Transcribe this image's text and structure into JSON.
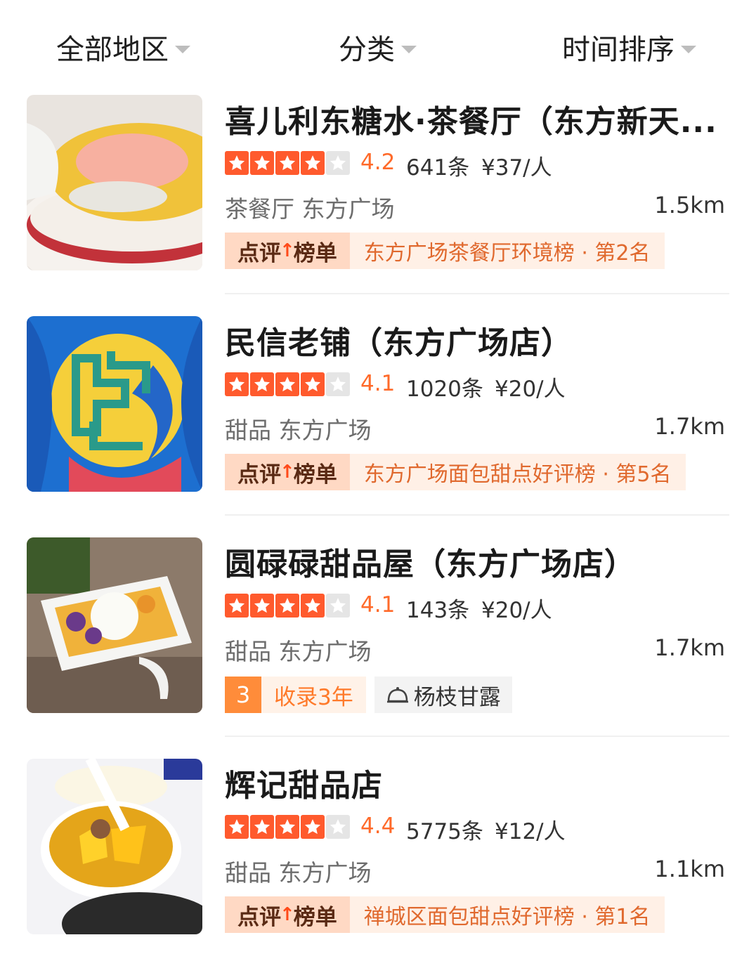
{
  "filters": [
    {
      "label": "全部地区"
    },
    {
      "label": "分类"
    },
    {
      "label": "时间排序"
    }
  ],
  "shops": [
    {
      "name": "喜儿利东糖水·茶餐厅（东方新天...",
      "rating": "4.2",
      "stars": 4,
      "reviews": "641条",
      "price": "¥37/人",
      "category": "茶餐厅 东方广场",
      "distance": "1.5km",
      "rank_tag_left": "点评",
      "rank_tag_right": "榜单",
      "rank_text": "东方广场茶餐厅环境榜 · 第2名"
    },
    {
      "name": "民信老铺（东方广场店）",
      "rating": "4.1",
      "stars": 4,
      "reviews": "1020条",
      "price": "¥20/人",
      "category": "甜品 东方广场",
      "distance": "1.7km",
      "rank_tag_left": "点评",
      "rank_tag_right": "榜单",
      "rank_text": "东方广场面包甜点好评榜 · 第5名"
    },
    {
      "name": "圆碌碌甜品屋（东方广场店）",
      "rating": "4.1",
      "stars": 4,
      "reviews": "143条",
      "price": "¥20/人",
      "category": "甜品 东方广场",
      "distance": "1.7km",
      "years_num": "3",
      "years_label": "收录3年",
      "dish": "杨枝甘露"
    },
    {
      "name": "辉记甜品店",
      "rating": "4.4",
      "stars": 4,
      "reviews": "5775条",
      "price": "¥12/人",
      "category": "甜品 东方广场",
      "distance": "1.1km",
      "rank_tag_left": "点评",
      "rank_tag_right": "榜单",
      "rank_text": "禅城区面包甜点好评榜 · 第1名"
    }
  ]
}
